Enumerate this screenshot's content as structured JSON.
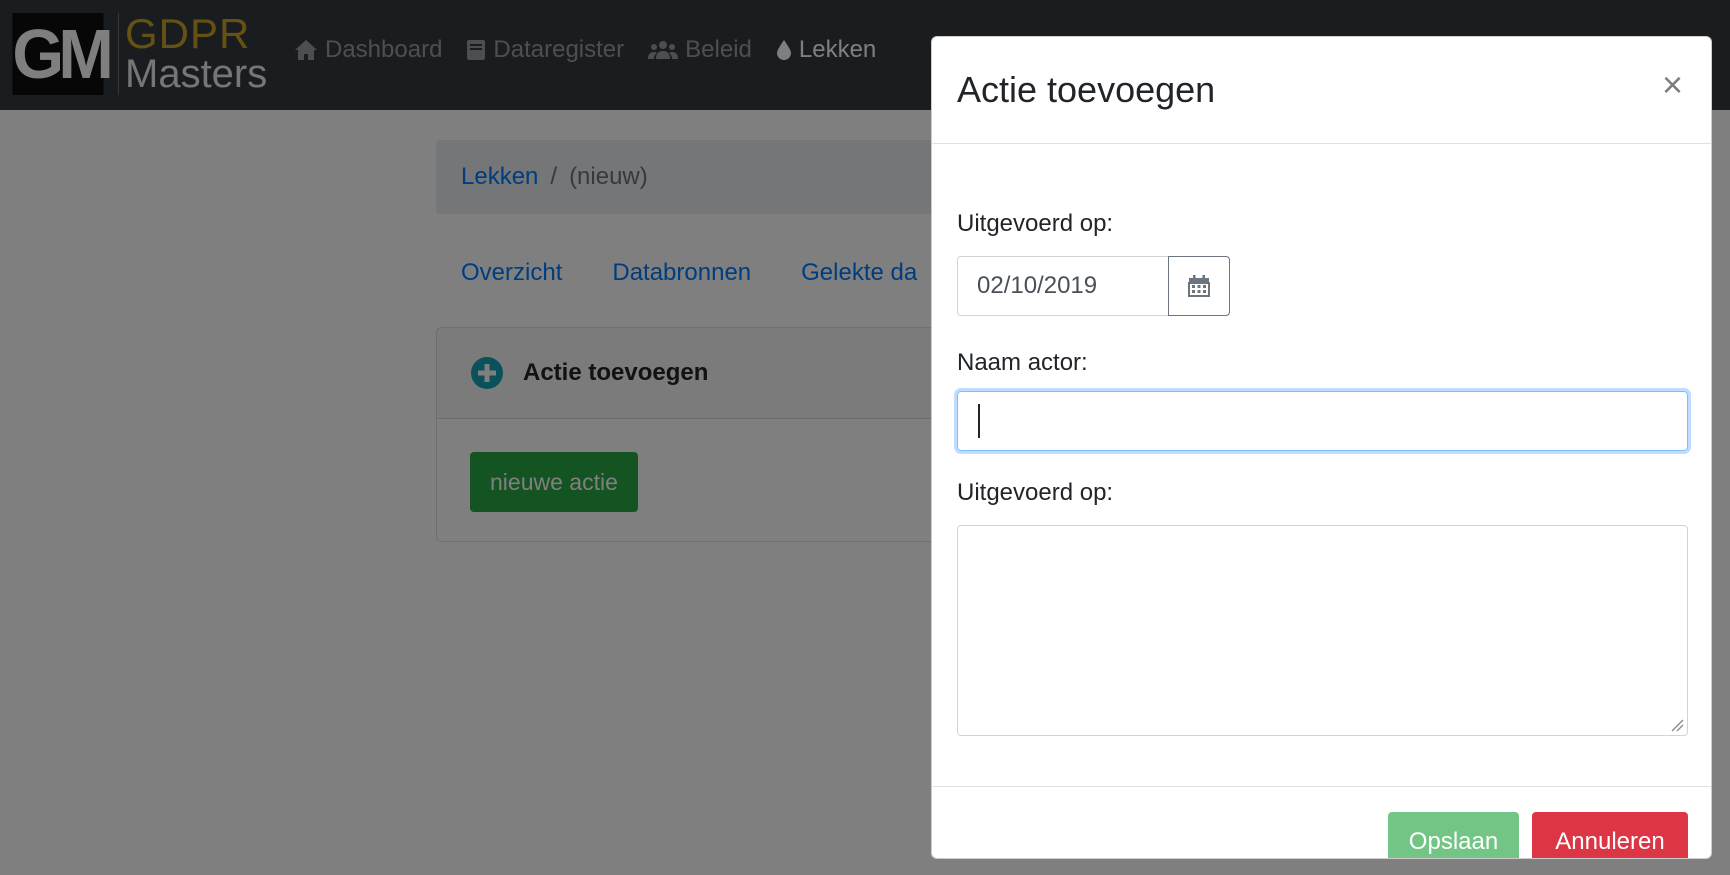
{
  "brand": {
    "logo_mark": "GM",
    "name_line1": "GDPR",
    "name_line2": "Masters"
  },
  "nav": {
    "items": [
      {
        "label": "Dashboard",
        "icon": "home-icon",
        "active": false
      },
      {
        "label": "Dataregister",
        "icon": "book-icon",
        "active": false
      },
      {
        "label": "Beleid",
        "icon": "users-icon",
        "active": false
      },
      {
        "label": "Lekken",
        "icon": "droplet-icon",
        "active": true
      }
    ]
  },
  "breadcrumb": {
    "parent": "Lekken",
    "separator": "/",
    "current": "(nieuw)"
  },
  "tabs": [
    "Overzicht",
    "Databronnen",
    "Gelekte da"
  ],
  "card": {
    "title": "Actie toevoegen",
    "button_label": "nieuwe actie"
  },
  "modal": {
    "title": "Actie toevoegen",
    "close_symbol": "×",
    "fields": {
      "date_label": "Uitgevoerd op:",
      "date_value": "02/10/2019",
      "actor_label": "Naam actor:",
      "actor_value": "",
      "description_label": "Uitgevoerd op:",
      "description_value": ""
    },
    "save_label": "Opslaan",
    "cancel_label": "Annuleren"
  },
  "colors": {
    "accent": "#007bff",
    "success": "#28a745",
    "danger": "#dc3545",
    "navbar": "#343a40",
    "brand_gold": "#c9a227"
  }
}
